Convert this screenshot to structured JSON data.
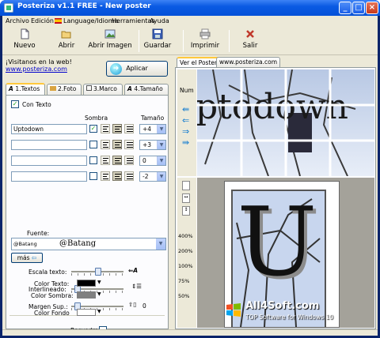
{
  "window": {
    "title": "Posteriza v1.1 FREE - New poster"
  },
  "menu": [
    {
      "label": "Archivo"
    },
    {
      "label": "Edición"
    },
    {
      "label": "Language/Idioma"
    },
    {
      "label": "Herramientas"
    },
    {
      "label": "Ayuda"
    }
  ],
  "toolbar": {
    "nuevo": "Nuevo",
    "abrir": "Abrir",
    "abrir_imagen": "Abrir Imagen",
    "guardar": "Guardar",
    "imprimir": "Imprimir",
    "salir": "Salir"
  },
  "promo": {
    "text": "¡Visitanos en la web!",
    "link": "www.posteriza.com"
  },
  "apply_label": "Aplicar",
  "tabs": [
    "1.Textos",
    "2.Foto",
    "3.Marco",
    "4.Tamaño"
  ],
  "textos": {
    "con_texto": "Con Texto",
    "sombra": "Sombra",
    "tamano": "Tamaño",
    "rows": [
      {
        "text": "Uptodown",
        "shadow": true,
        "size": "+4"
      },
      {
        "text": "",
        "shadow": false,
        "size": "+3"
      },
      {
        "text": "",
        "shadow": false,
        "size": "0"
      },
      {
        "text": "",
        "shadow": false,
        "size": "-2"
      }
    ],
    "fuente_label": "Fuente:",
    "font_name": "@Batang",
    "font_preview": "@Batang",
    "mas": "más",
    "escala": "Escala texto:",
    "interlineado": "Interlineado:",
    "margen": "Margen Sup.:",
    "margen_value": "0",
    "color_texto": "Color Texto:",
    "color_sombra": "Color Sombra:",
    "color_fondo": "Color Fondo",
    "recuadra": "Recuadra:",
    "colors": {
      "texto": "#000000",
      "sombra": "#808080",
      "fondo": "#ffffff"
    }
  },
  "preview_tabs": [
    "Ver el Poster",
    "www.posteriza.com"
  ],
  "poster_text": "ptodown",
  "big_letter": "U",
  "zoom_levels": [
    "400%",
    "200%",
    "100%",
    "75%",
    "50%"
  ],
  "watermark": {
    "brand": "All4Soft",
    "domain": ".com",
    "tagline": "TOP Software for Windows 10"
  }
}
